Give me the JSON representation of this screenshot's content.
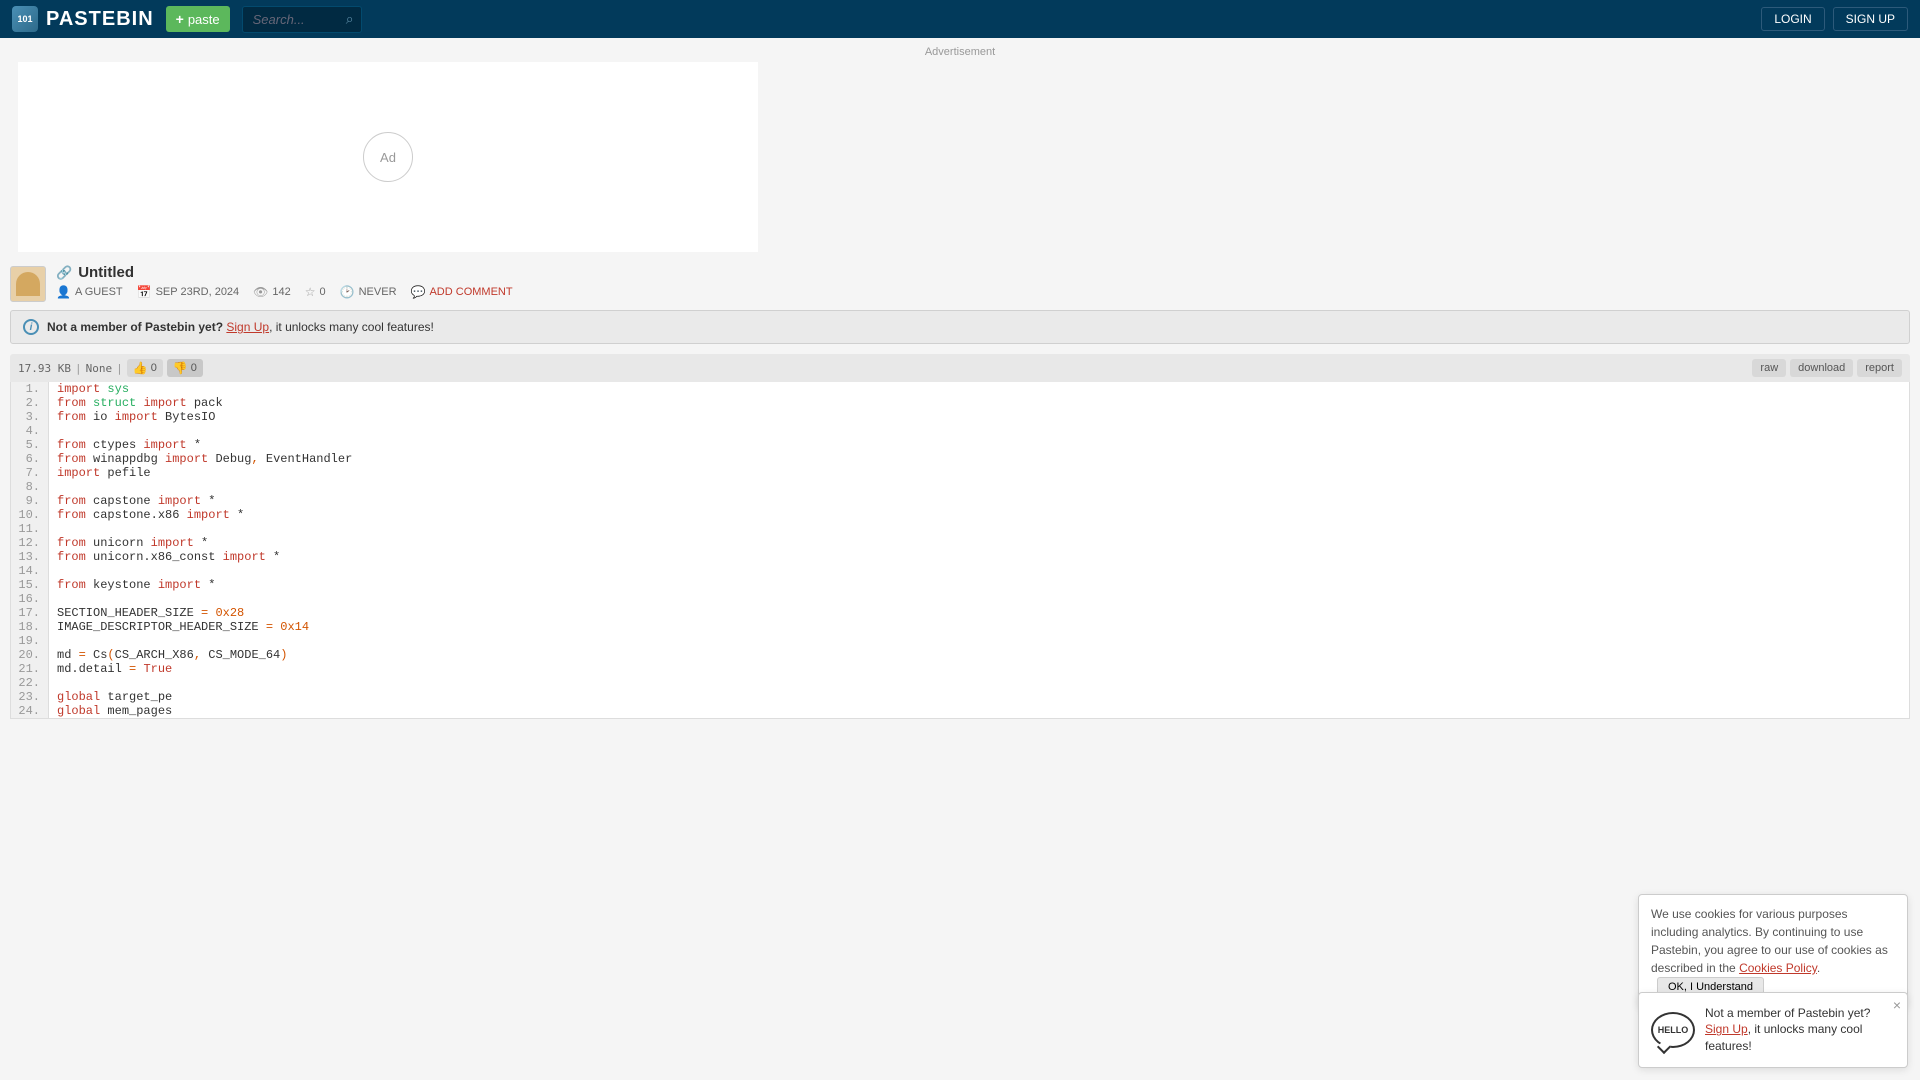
{
  "header": {
    "brand": "PASTEBIN",
    "paste_btn": "paste",
    "search_placeholder": "Search...",
    "login": "LOGIN",
    "signup": "SIGN UP"
  },
  "ad": {
    "label": "Advertisement",
    "text": "Ad"
  },
  "paste": {
    "title": "Untitled",
    "author": "A GUEST",
    "date": "SEP 23RD, 2024",
    "views": "142",
    "rating": "0",
    "expiry": "NEVER",
    "add_comment": "ADD COMMENT"
  },
  "banner": {
    "prefix": "Not a member of Pastebin yet? ",
    "link": "Sign Up",
    "suffix": ", it unlocks many cool features!"
  },
  "toolbar": {
    "size": "17.93 KB",
    "syntax": "None",
    "likes": "0",
    "dislikes": "0",
    "raw": "raw",
    "download": "download",
    "report": "report"
  },
  "code": {
    "lines": [
      {
        "n": "1.",
        "segs": [
          [
            "kw-red",
            "import"
          ],
          [
            "",
            " "
          ],
          [
            "kw-green",
            "sys"
          ]
        ]
      },
      {
        "n": "2.",
        "segs": [
          [
            "kw-red",
            "from"
          ],
          [
            "",
            " "
          ],
          [
            "kw-green",
            "struct"
          ],
          [
            "",
            " "
          ],
          [
            "kw-red",
            "import"
          ],
          [
            "",
            " pack"
          ]
        ]
      },
      {
        "n": "3.",
        "segs": [
          [
            "kw-red",
            "from"
          ],
          [
            "",
            " io "
          ],
          [
            "kw-red",
            "import"
          ],
          [
            "",
            " BytesIO"
          ]
        ]
      },
      {
        "n": "4.",
        "segs": [
          [
            "",
            ""
          ]
        ]
      },
      {
        "n": "5.",
        "segs": [
          [
            "kw-red",
            "from"
          ],
          [
            "",
            " ctypes "
          ],
          [
            "kw-red",
            "import"
          ],
          [
            "",
            " *"
          ]
        ]
      },
      {
        "n": "6.",
        "segs": [
          [
            "kw-red",
            "from"
          ],
          [
            "",
            " winappdbg "
          ],
          [
            "kw-red",
            "import"
          ],
          [
            "",
            " Debug"
          ],
          [
            "kw-orange",
            ","
          ],
          [
            "",
            " EventHandler"
          ]
        ]
      },
      {
        "n": "7.",
        "segs": [
          [
            "kw-red",
            "import"
          ],
          [
            "",
            " pefile"
          ]
        ]
      },
      {
        "n": "8.",
        "segs": [
          [
            "",
            ""
          ]
        ]
      },
      {
        "n": "9.",
        "segs": [
          [
            "kw-red",
            "from"
          ],
          [
            "",
            " capstone "
          ],
          [
            "kw-red",
            "import"
          ],
          [
            "",
            " *"
          ]
        ]
      },
      {
        "n": "10.",
        "segs": [
          [
            "kw-red",
            "from"
          ],
          [
            "",
            " capstone."
          ],
          [
            "",
            "x86 "
          ],
          [
            "kw-red",
            "import"
          ],
          [
            "",
            " *"
          ]
        ]
      },
      {
        "n": "11.",
        "segs": [
          [
            "",
            ""
          ]
        ]
      },
      {
        "n": "12.",
        "segs": [
          [
            "kw-red",
            "from"
          ],
          [
            "",
            " unicorn "
          ],
          [
            "kw-red",
            "import"
          ],
          [
            "",
            " *"
          ]
        ]
      },
      {
        "n": "13.",
        "segs": [
          [
            "kw-red",
            "from"
          ],
          [
            "",
            " unicorn."
          ],
          [
            "",
            "x86_const "
          ],
          [
            "kw-red",
            "import"
          ],
          [
            "",
            " *"
          ]
        ]
      },
      {
        "n": "14.",
        "segs": [
          [
            "",
            ""
          ]
        ]
      },
      {
        "n": "15.",
        "segs": [
          [
            "kw-red",
            "from"
          ],
          [
            "",
            " keystone "
          ],
          [
            "kw-red",
            "import"
          ],
          [
            "",
            " *"
          ]
        ]
      },
      {
        "n": "16.",
        "segs": [
          [
            "",
            ""
          ]
        ]
      },
      {
        "n": "17.",
        "segs": [
          [
            "",
            "SECTION_HEADER_SIZE "
          ],
          [
            "kw-orange",
            "="
          ],
          [
            "",
            " "
          ],
          [
            "kw-orange",
            "0x28"
          ]
        ]
      },
      {
        "n": "18.",
        "segs": [
          [
            "",
            "IMAGE_DESCRIPTOR_HEADER_SIZE "
          ],
          [
            "kw-orange",
            "="
          ],
          [
            "",
            " "
          ],
          [
            "kw-orange",
            "0x14"
          ]
        ]
      },
      {
        "n": "19.",
        "segs": [
          [
            "",
            ""
          ]
        ]
      },
      {
        "n": "20.",
        "segs": [
          [
            "",
            "md "
          ],
          [
            "kw-orange",
            "="
          ],
          [
            "",
            " Cs"
          ],
          [
            "kw-orange",
            "("
          ],
          [
            "",
            "CS_ARCH_X86"
          ],
          [
            "kw-orange",
            ","
          ],
          [
            "",
            " CS_MODE_64"
          ],
          [
            "kw-orange",
            ")"
          ]
        ]
      },
      {
        "n": "21.",
        "segs": [
          [
            "",
            "md."
          ],
          [
            "",
            "detail "
          ],
          [
            "kw-orange",
            "="
          ],
          [
            "",
            " "
          ],
          [
            "kw-red",
            "True"
          ]
        ]
      },
      {
        "n": "22.",
        "segs": [
          [
            "",
            ""
          ]
        ]
      },
      {
        "n": "23.",
        "segs": [
          [
            "kw-red",
            "global"
          ],
          [
            "",
            " target_pe"
          ]
        ]
      },
      {
        "n": "24.",
        "segs": [
          [
            "kw-red",
            "global"
          ],
          [
            "",
            " mem_pages"
          ]
        ]
      }
    ]
  },
  "cookie": {
    "text1": "We use cookies for various purposes including analytics. By continuing to use Pastebin, you agree to our use of cookies as described in the ",
    "link": "Cookies Policy",
    "text2": ". ",
    "ok": "OK, I Understand"
  },
  "hello": {
    "bubble": "HELLO",
    "line1": "Not a member of Pastebin yet?",
    "link": "Sign Up",
    "line2": ", it unlocks many cool features!"
  }
}
